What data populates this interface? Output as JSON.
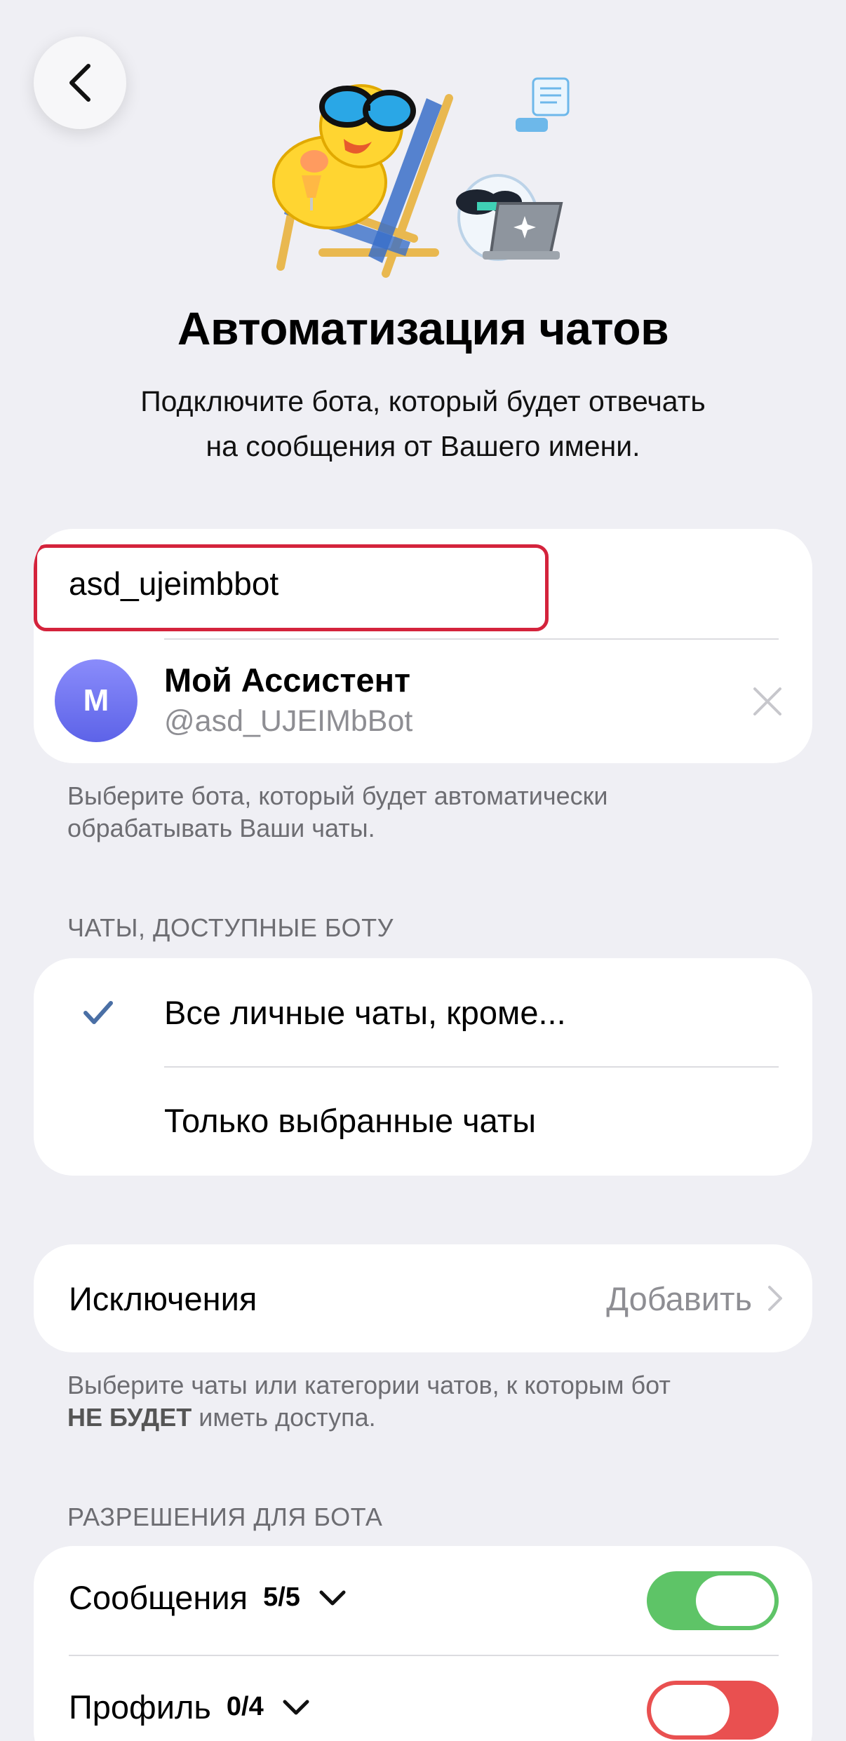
{
  "header": {
    "back_icon": "chevron-left-icon",
    "sticker": "duck-on-deckchair-and-bot-with-laptop-sticker",
    "title": "Автоматизация чатов",
    "subtitle_line1": "Подключите бота, который будет отвечать",
    "subtitle_line2": "на сообщения от Вашего имени."
  },
  "bot": {
    "input_value": "asd_ujeimbbot",
    "avatar_letter": "M",
    "name": "Мой Ассистент",
    "handle": "@asd_UJEIMbBot",
    "clear_icon": "close-icon",
    "footnote_line1": "Выберите бота, который будет автоматически",
    "footnote_line2": "обрабатывать Ваши чаты."
  },
  "chats": {
    "section_title": "ЧАТЫ, ДОСТУПНЫЕ БОТУ",
    "options": [
      {
        "label": "Все личные чаты, кроме...",
        "selected": true
      },
      {
        "label": "Только выбранные чаты",
        "selected": false
      }
    ]
  },
  "exceptions": {
    "label": "Исключения",
    "action": "Добавить",
    "footnote_line1": "Выберите чаты или категории чатов, к которым бот",
    "footnote_bold": "НЕ БУДЕТ",
    "footnote_rest": " иметь доступа."
  },
  "permissions": {
    "section_title": "РАЗРЕШЕНИЯ ДЛЯ БОТА",
    "items": [
      {
        "label": "Сообщения",
        "count": "5/5",
        "enabled": true
      },
      {
        "label": "Профиль",
        "count": "0/4",
        "enabled": false
      }
    ]
  },
  "colors": {
    "accent": "#4a6fa5",
    "toggle_on": "#5ec467",
    "toggle_off": "#e95050",
    "highlight": "#d4233c"
  }
}
